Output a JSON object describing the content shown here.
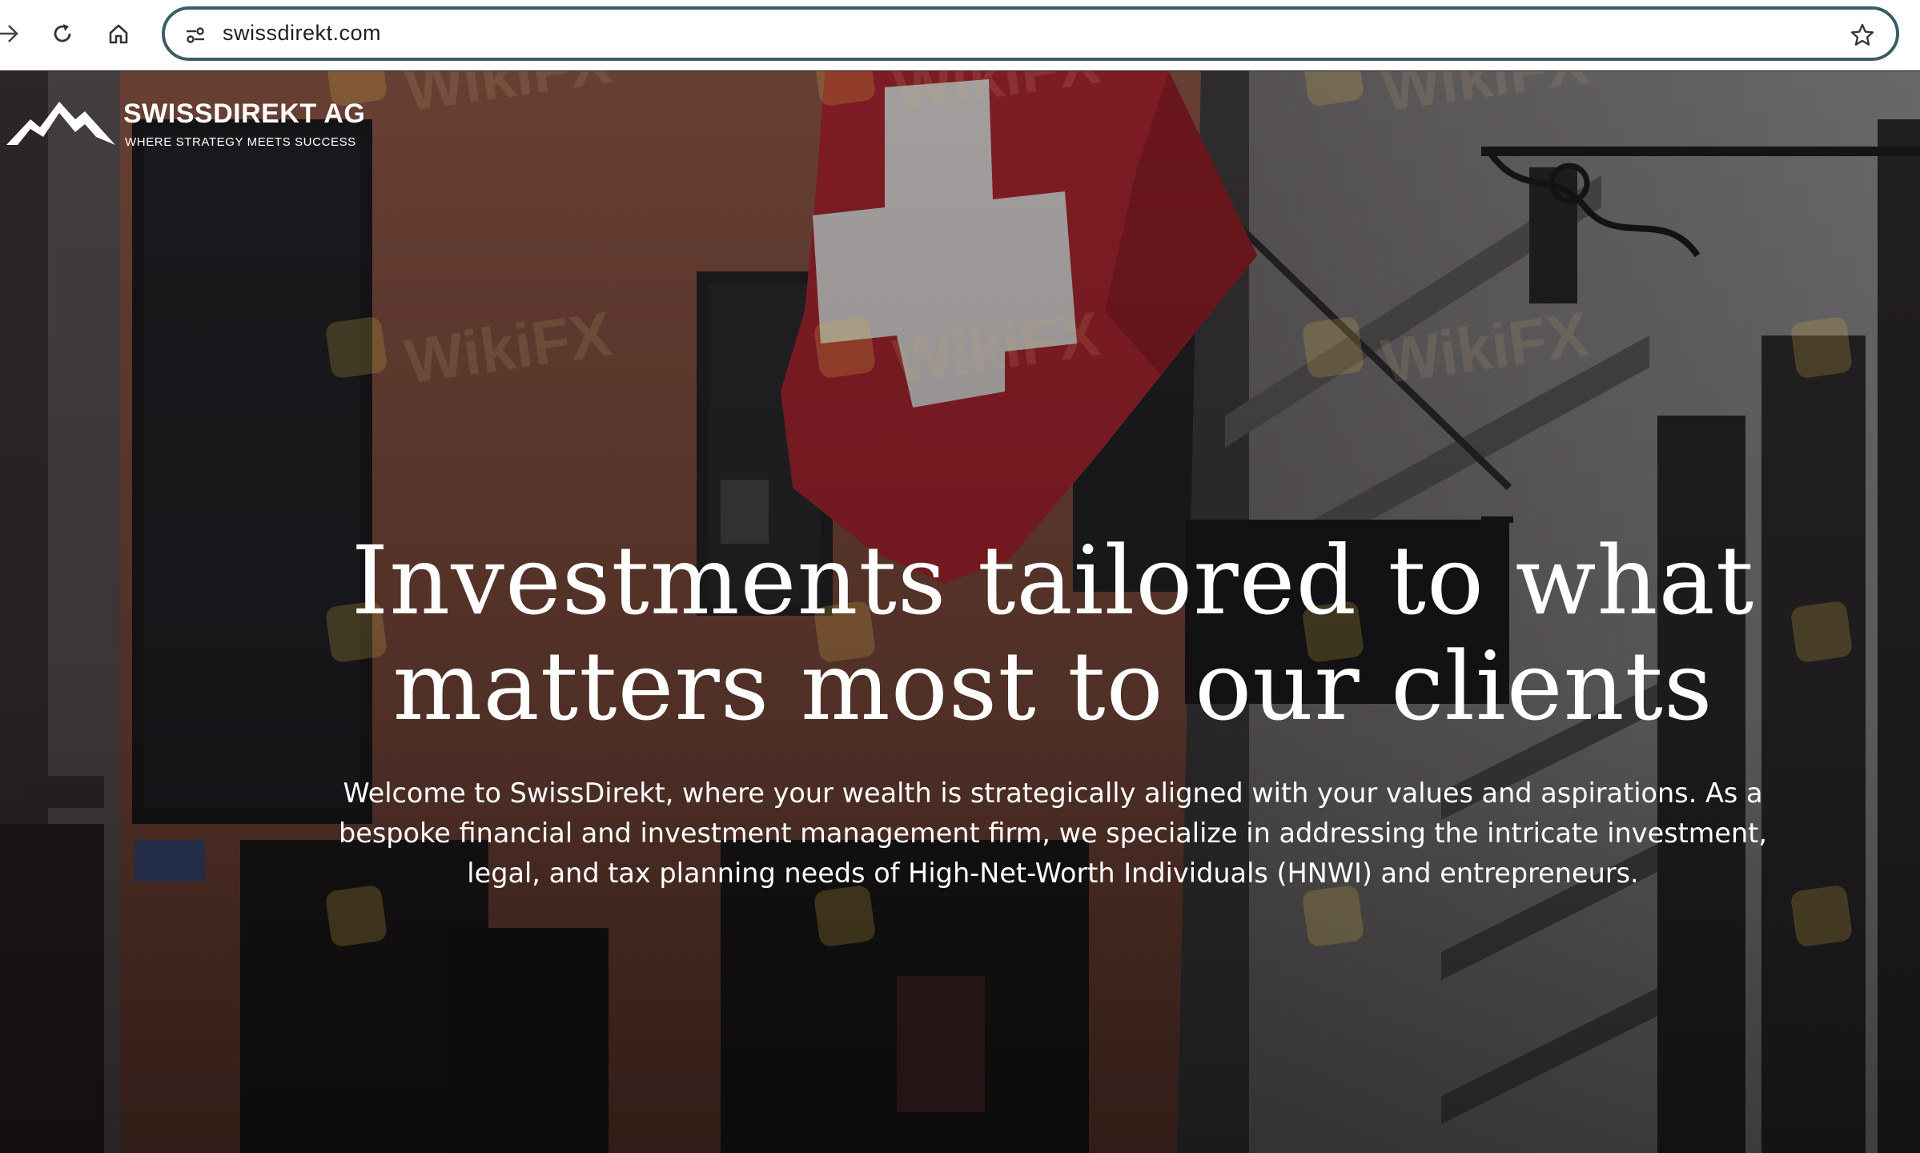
{
  "browser": {
    "url": "swissdirekt.com",
    "icons": {
      "back": "back-arrow-icon",
      "reload": "reload-icon",
      "home": "home-icon",
      "site_info": "site-settings-icon",
      "bookmark": "star-icon"
    }
  },
  "site": {
    "brand_name": "SWISSDIREKT AG",
    "tagline": "WHERE STRATEGY MEETS SUCCESS",
    "logo_icon": "mountain-logo-icon"
  },
  "hero": {
    "headline_line1": "Investments tailored to what",
    "headline_line2": "matters most to our clients",
    "intro_line1": "Welcome to SwissDirekt, where your wealth is strategically aligned with your values and aspirations. As a",
    "intro_line2": "bespoke financial and investment management firm, we specialize in addressing the intricate investment,",
    "intro_line3": "legal, and tax planning needs of High-Net-Worth Individuals (HNWI) and entrepreneurs."
  },
  "watermark": {
    "text": "WikiFX"
  },
  "colors": {
    "omnibox_border": "#3b5d63",
    "flag_red": "#c4262e",
    "hero_text": "#ffffff",
    "facade_terracotta": "#b86a52"
  }
}
